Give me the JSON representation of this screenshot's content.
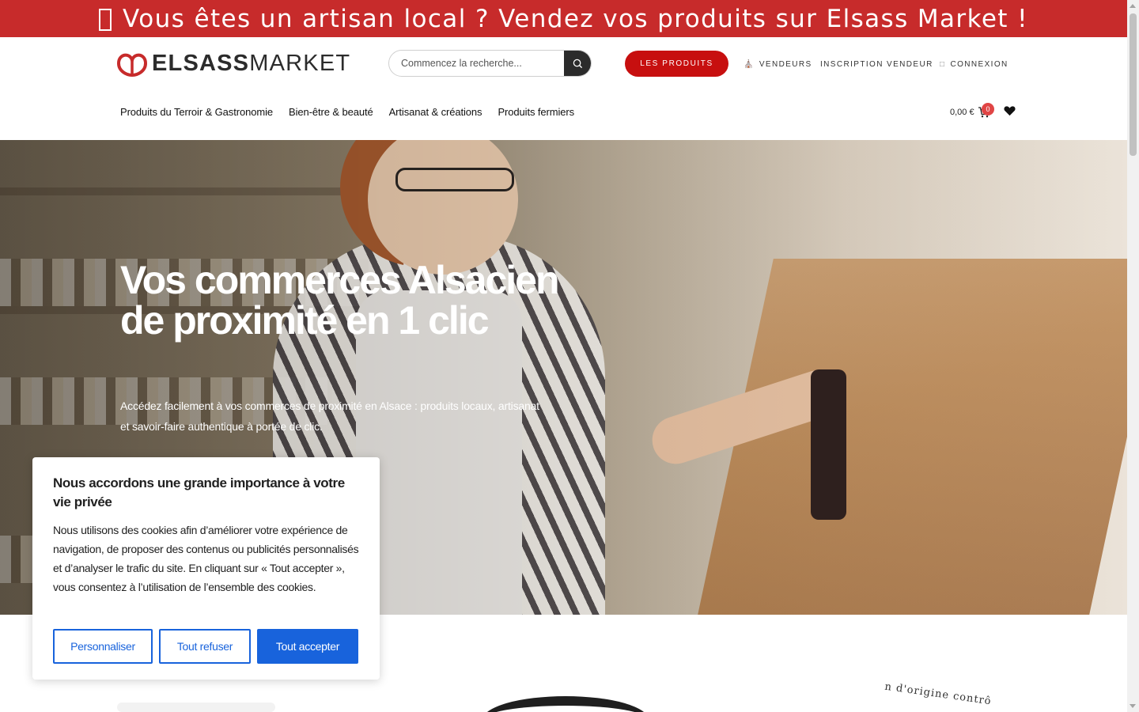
{
  "announcement": {
    "text": "Vous êtes un artisan local ? Vendez vos produits sur Elsass Market !"
  },
  "brand": {
    "bold": "ELSASS",
    "light": "MARKET",
    "accent": "#c72b2b"
  },
  "search": {
    "placeholder": "Commencez la recherche..."
  },
  "header": {
    "products_button": "LES PRODUITS",
    "vendors_link": "VENDEURS",
    "vendor_signup_link": "INSCRIPTION VENDEUR",
    "login_link": "CONNEXION"
  },
  "nav": {
    "items": [
      {
        "label": "Produits du Terroir & Gastronomie"
      },
      {
        "label": "Bien-être & beauté"
      },
      {
        "label": "Artisanat & créations"
      },
      {
        "label": "Produits fermiers"
      }
    ]
  },
  "cart": {
    "total": "0,00 €",
    "count": "0"
  },
  "hero": {
    "title": "Vos commerces Alsacien de proximité en 1 clic",
    "subtitle": "Accédez facilement à vos commerces de proximité en Alsace : produits locaux, artisanat et savoir-faire authentique à portée de clic."
  },
  "cookie": {
    "title": "Nous accordons une grande importance à votre vie privée",
    "body": "Nous utilisons des cookies afin d’améliorer votre expérience de navigation, de proposer des contenus ou publicités personnalisés et d’analyser le trafic du site. En cliquant sur « Tout accepter », vous consentez à l’utilisation de l’ensemble des cookies.",
    "customize": "Personnaliser",
    "reject": "Tout refuser",
    "accept": "Tout accepter",
    "accent": "#1863dc"
  },
  "below": {
    "seal_text": "n d'origine contrô"
  },
  "icons": [
    "search-icon",
    "store-icon",
    "user-icon",
    "cart-icon",
    "heart-icon",
    "missing-glyph-icon"
  ]
}
